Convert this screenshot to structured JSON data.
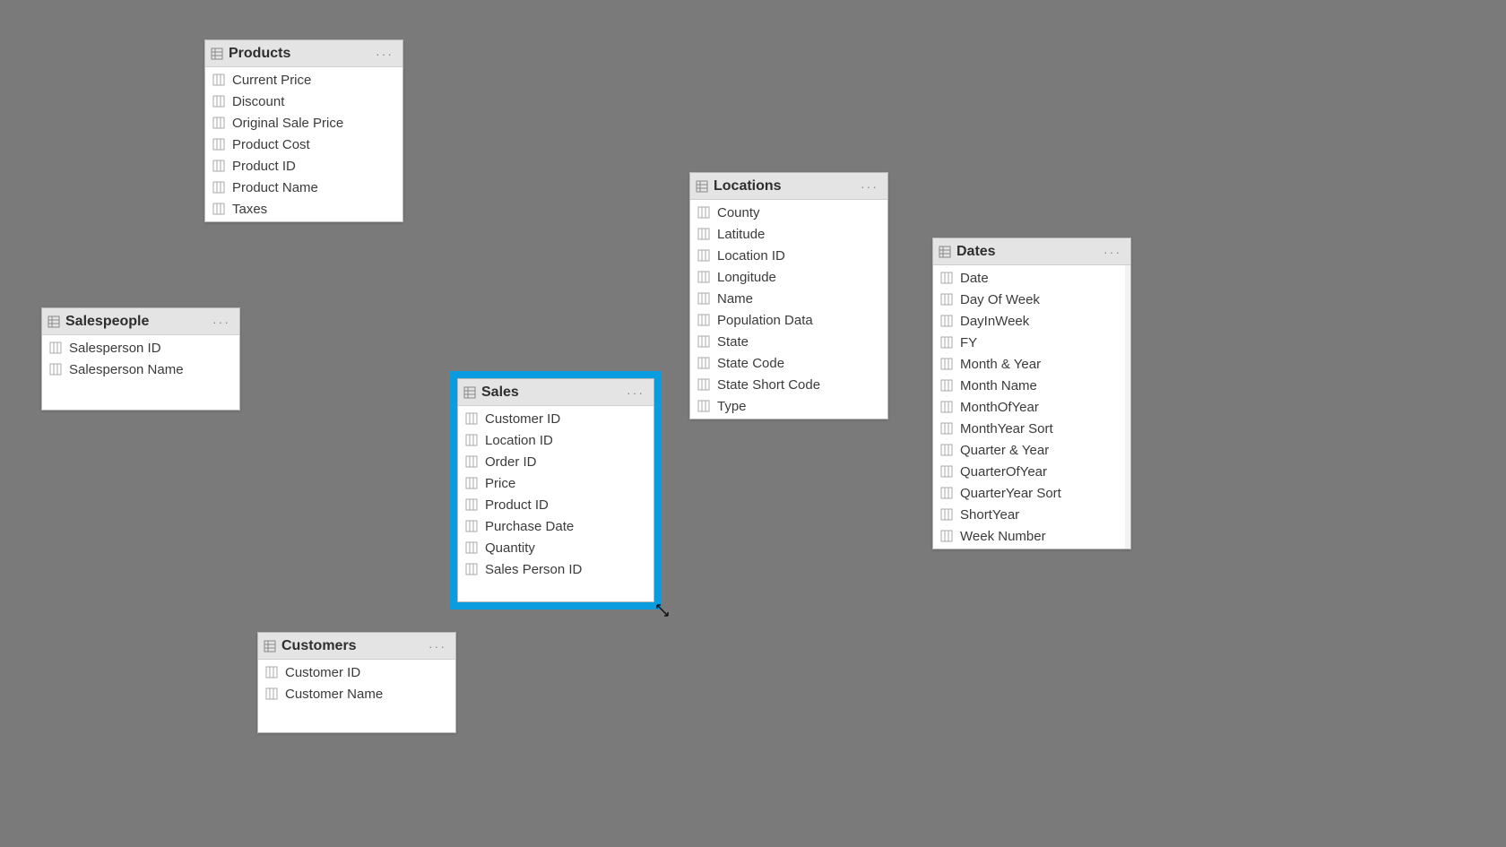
{
  "tables": {
    "products": {
      "title": "Products",
      "fields": [
        "Current Price",
        "Discount",
        "Original Sale Price",
        "Product Cost",
        "Product ID",
        "Product Name",
        "Taxes"
      ]
    },
    "salespeople": {
      "title": "Salespeople",
      "fields": [
        "Salesperson ID",
        "Salesperson Name"
      ]
    },
    "sales": {
      "title": "Sales",
      "fields": [
        "Customer ID",
        "Location ID",
        "Order ID",
        "Price",
        "Product ID",
        "Purchase Date",
        "Quantity",
        "Sales Person ID"
      ]
    },
    "locations": {
      "title": "Locations",
      "fields": [
        "County",
        "Latitude",
        "Location ID",
        "Longitude",
        "Name",
        "Population Data",
        "State",
        "State Code",
        "State Short Code",
        "Type"
      ]
    },
    "dates": {
      "title": "Dates",
      "fields": [
        "Date",
        "Day Of Week",
        "DayInWeek",
        "FY",
        "Month & Year",
        "Month Name",
        "MonthOfYear",
        "MonthYear Sort",
        "Quarter & Year",
        "QuarterOfYear",
        "QuarterYear Sort",
        "ShortYear",
        "Week Number"
      ]
    },
    "customers": {
      "title": "Customers",
      "fields": [
        "Customer ID",
        "Customer Name"
      ]
    }
  },
  "more_label": "···"
}
